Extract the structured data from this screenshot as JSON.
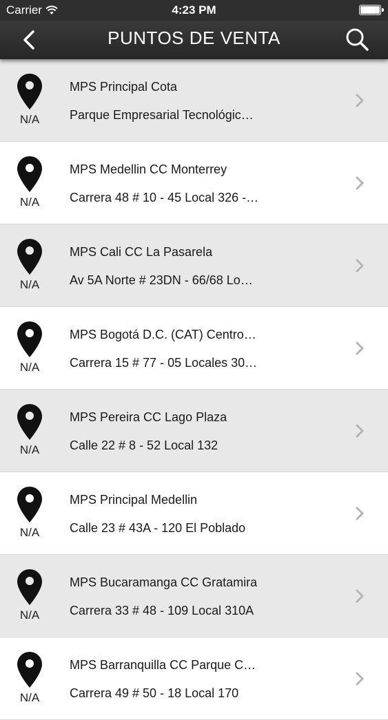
{
  "status_bar": {
    "carrier": "Carrier",
    "time": "4:23 PM"
  },
  "nav": {
    "title": "PUNTOS DE VENTA",
    "back_icon": "chevron-left-icon",
    "search_icon": "search-icon"
  },
  "stores": [
    {
      "name": "MPS Principal Cota",
      "address": "Parque Empresarial Tecnológic…",
      "distance": "N/A"
    },
    {
      "name": "MPS Medellin CC Monterrey",
      "address": "Carrera 48 # 10 - 45 Local 326 -…",
      "distance": "N/A"
    },
    {
      "name": "MPS Cali CC La Pasarela",
      "address": "Av 5A Norte # 23DN - 66/68 Lo…",
      "distance": "N/A"
    },
    {
      "name": "MPS Bogotá D.C. (CAT) Centro…",
      "address": "Carrera 15 # 77 - 05 Locales 30…",
      "distance": "N/A"
    },
    {
      "name": "MPS Pereira CC Lago Plaza",
      "address": "Calle 22 # 8 - 52 Local 132",
      "distance": "N/A"
    },
    {
      "name": "MPS Principal Medellin",
      "address": "Calle 23 # 43A - 120 El Poblado",
      "distance": "N/A"
    },
    {
      "name": "MPS Bucaramanga CC Gratamira",
      "address": "Carrera 33 # 48 - 109 Local 310A",
      "distance": "N/A"
    },
    {
      "name": "MPS Barranquilla CC Parque C…",
      "address": "Carrera 49 # 50 - 18 Local 170",
      "distance": "N/A"
    }
  ]
}
